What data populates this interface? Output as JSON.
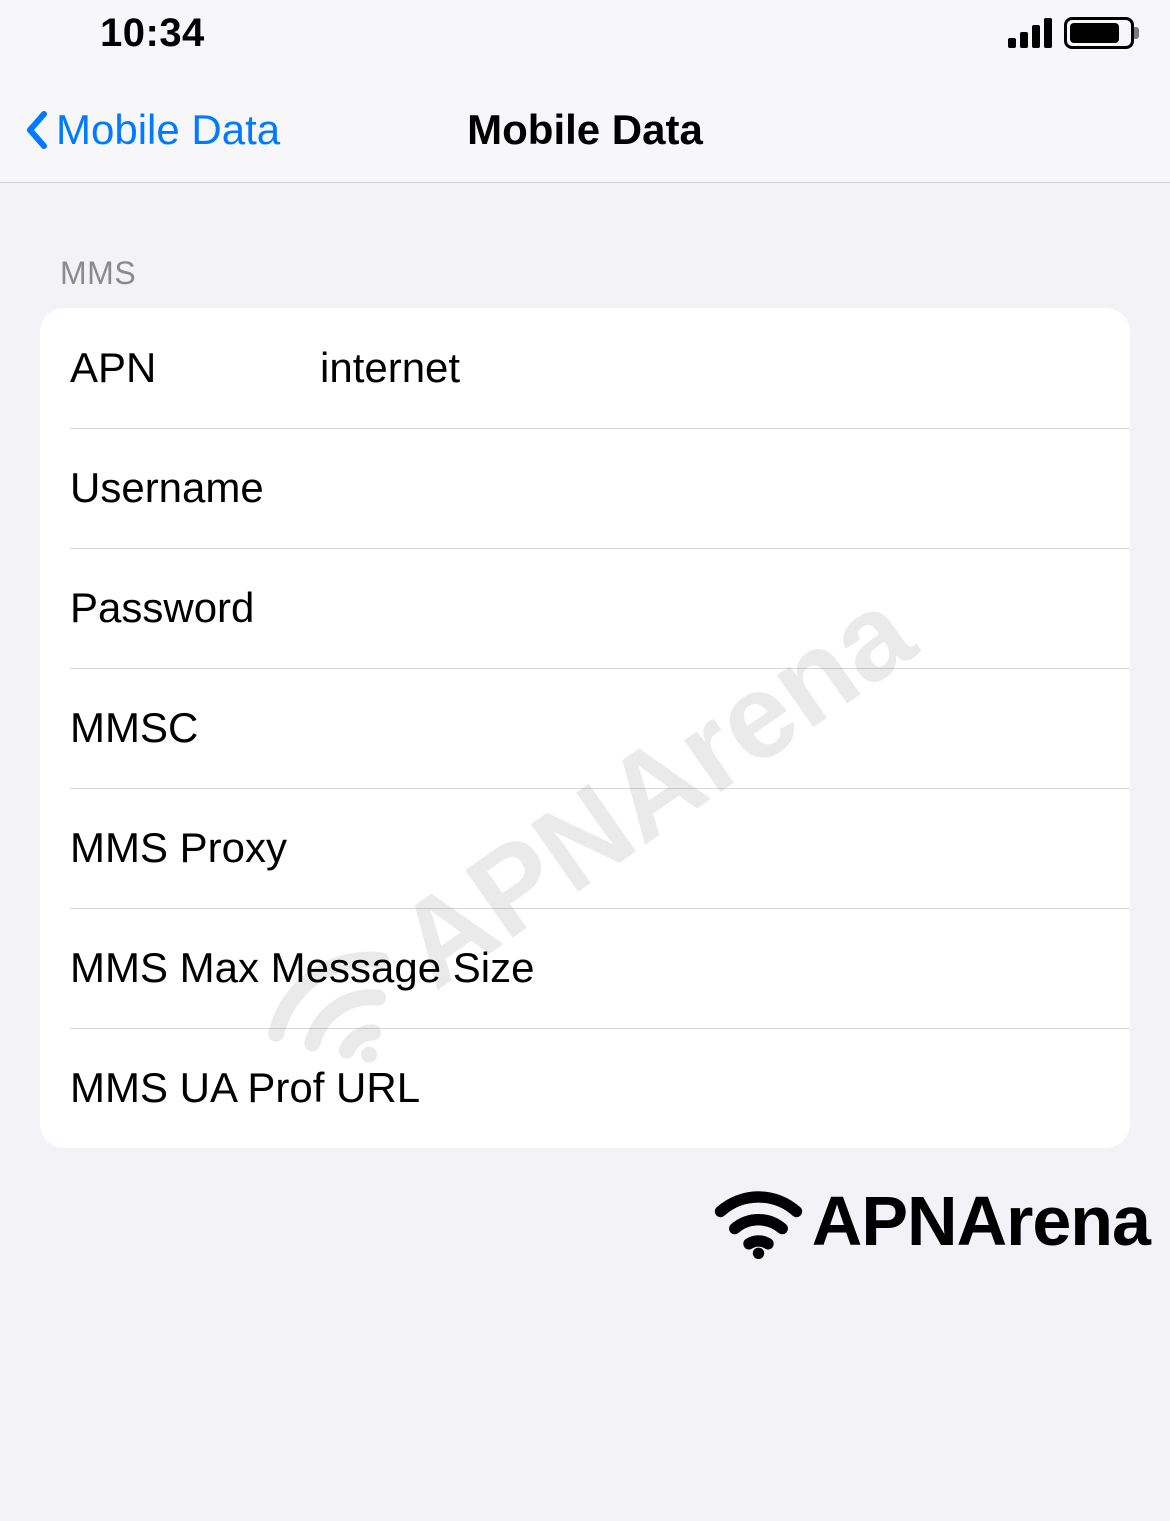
{
  "status_bar": {
    "time": "10:34"
  },
  "nav": {
    "back_label": "Mobile Data",
    "title": "Mobile Data"
  },
  "section_header": "MMS",
  "fields": {
    "apn": {
      "label": "APN",
      "value": "internet"
    },
    "username": {
      "label": "Username",
      "value": ""
    },
    "password": {
      "label": "Password",
      "value": ""
    },
    "mmsc": {
      "label": "MMSC",
      "value": ""
    },
    "mms_proxy": {
      "label": "MMS Proxy",
      "value": ""
    },
    "mms_max_size": {
      "label": "MMS Max Message Size",
      "value": ""
    },
    "mms_ua_prof": {
      "label": "MMS UA Prof URL",
      "value": ""
    }
  },
  "watermark": "APNArena"
}
